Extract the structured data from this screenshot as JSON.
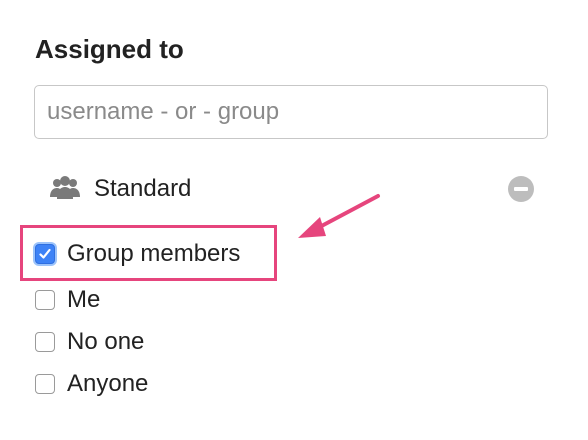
{
  "section": {
    "title": "Assigned to"
  },
  "search": {
    "placeholder": "username - or - group",
    "value": ""
  },
  "assigned_group": {
    "label": "Standard",
    "icon": "group-icon",
    "remove_icon": "remove-icon"
  },
  "options": [
    {
      "label": "Group members",
      "checked": true
    },
    {
      "label": "Me",
      "checked": false
    },
    {
      "label": "No one",
      "checked": false
    },
    {
      "label": "Anyone",
      "checked": false
    }
  ],
  "annotation": {
    "highlight_color": "#e6457d",
    "arrow_color": "#e6457d"
  },
  "colors": {
    "accent": "#3d82f6",
    "text": "#222222",
    "placeholder": "#8a8a8a"
  }
}
